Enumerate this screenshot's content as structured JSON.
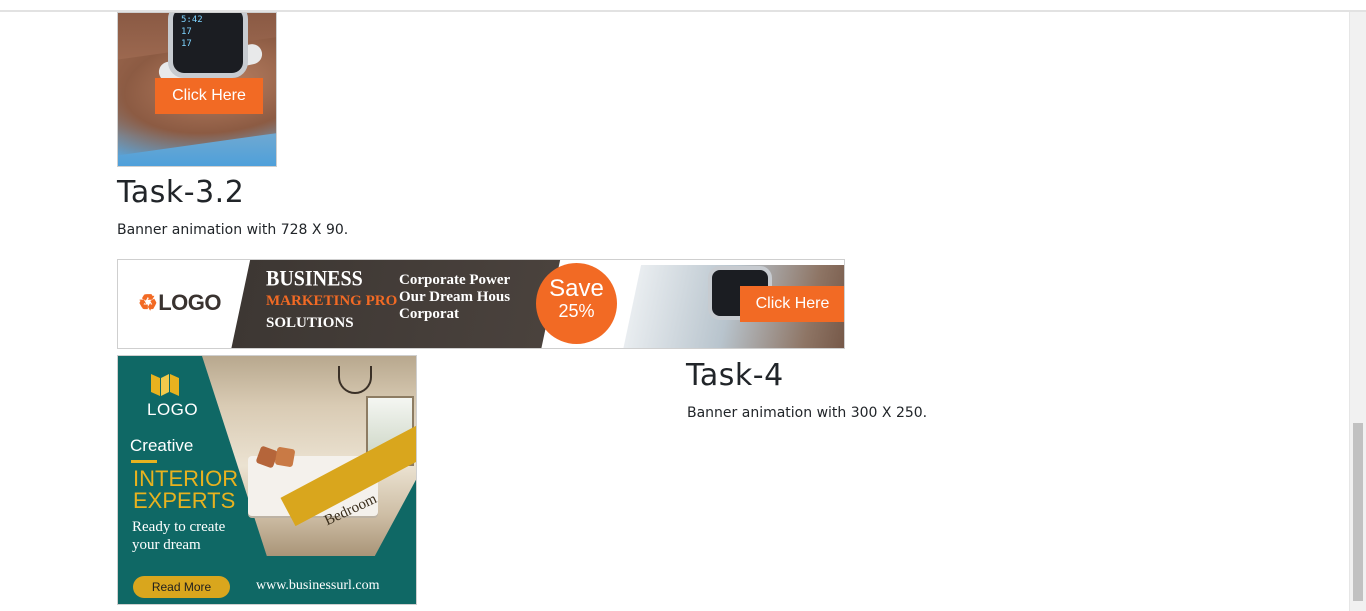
{
  "banners": {
    "top_watch": {
      "cta": "Click Here",
      "watch_lines": [
        "5:42",
        "17",
        "17"
      ]
    },
    "wide": {
      "logo": "LOGO",
      "headline_1": "BUSINESS",
      "headline_2": "MARKETING PRO",
      "headline_3": "SOLUTIONS",
      "tagline_lines": [
        "Corporate Power",
        "Our Dream Hous",
        "Corporat"
      ],
      "save_line_1": "Save",
      "save_line_2": "25%",
      "cta": "Click Here"
    },
    "interior": {
      "logo": "LOGO",
      "kicker": "Creative",
      "headline_lines": [
        "INTERIOR",
        "EXPERTS"
      ],
      "sub_lines": [
        "Ready to create",
        "your dream"
      ],
      "ribbon": "Bedroom",
      "cta": "Read More",
      "url": "www.businessurl.com"
    }
  },
  "sections": {
    "task_3_2": {
      "title": "Task-3.2",
      "description": "Banner animation with 728 X 90."
    },
    "task_4": {
      "title": "Task-4",
      "description": "Banner animation with 300 X 250."
    }
  },
  "colors": {
    "accent_orange": "#f26a24",
    "gold": "#d9a61d",
    "teal": "#0f6865"
  }
}
